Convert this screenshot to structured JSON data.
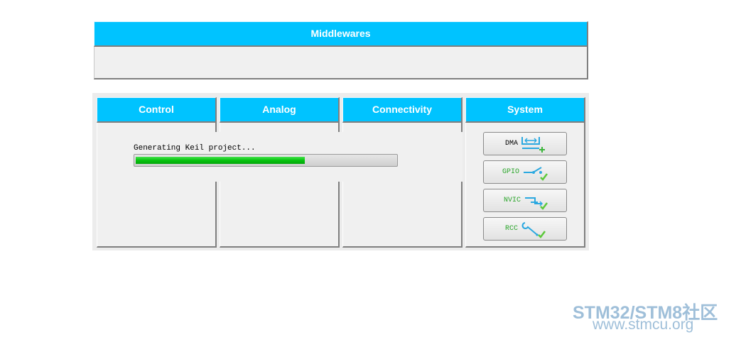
{
  "middlewares": {
    "title": "Middlewares"
  },
  "categories": {
    "control": "Control",
    "analog": "Analog",
    "connectivity": "Connectivity",
    "system": "System"
  },
  "progress": {
    "label": "Generating Keil project...",
    "fraction": 0.65,
    "color": "#06c30e"
  },
  "system": {
    "buttons": [
      {
        "label": "DMA",
        "icon": "dma-add-icon",
        "label_color": "#000000"
      },
      {
        "label": "GPIO",
        "icon": "gpio-check-icon",
        "label_color": "#2aa52a"
      },
      {
        "label": "NVIC",
        "icon": "nvic-check-icon",
        "label_color": "#2aa52a"
      },
      {
        "label": "RCC",
        "icon": "rcc-check-icon",
        "label_color": "#2aa52a"
      }
    ]
  },
  "watermark": {
    "line1": "STM32/STM8社区",
    "line2": "www.stmcu.org"
  },
  "colors": {
    "header_bg": "#00c3ff",
    "panel_bg": "#f0f0f0",
    "icon_blue": "#2aa8e0",
    "check_green": "#5cc83a"
  }
}
